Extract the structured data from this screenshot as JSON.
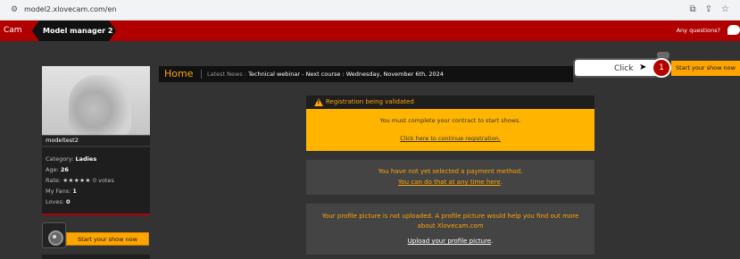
{
  "browser": {
    "url": "model2.xlovecam.com/en",
    "icons": [
      "tune-icon",
      "install-icon",
      "share-icon",
      "star-icon"
    ]
  },
  "header": {
    "brand": "Cam",
    "tab": "Model manager 2",
    "questions": "Any questions?"
  },
  "sidebar": {
    "username": "modeltest2",
    "category_label": "Category:",
    "category_value": "Ladies",
    "age_label": "Age:",
    "age_value": "26",
    "rate_label": "Rate:",
    "rate_stars": "★★★★★",
    "rate_votes": "0 votes",
    "fans_label": "My Fans:",
    "fans_value": "1",
    "loves_label": "Loves:",
    "loves_value": "0",
    "start_button": "Start your show now"
  },
  "news": {
    "home": "Home",
    "label": "Latest News :",
    "text": "Technical webinar - Next course : Wednesday, November 6th, 2024"
  },
  "tutorial": {
    "click_text": "Click",
    "step": "1",
    "start_button": "Start your show now"
  },
  "registration": {
    "title": "Registration being validated",
    "message": "You must complete your contract to start shows.",
    "link": "Click here to continue registration."
  },
  "payment": {
    "line1": "You have not yet selected a payment method.",
    "line2_link": "You can do that at any time here",
    "line2_end": "."
  },
  "picture": {
    "line1": "Your profile picture is not uploaded. A profile picture would help you find out more about Xlovecam.com",
    "link": "Upload your profile picture",
    "end": "."
  },
  "colors": {
    "header_red": "#b00000",
    "accent_orange": "#ffa500",
    "warning_yellow": "#ffb400",
    "background": "#333333"
  }
}
